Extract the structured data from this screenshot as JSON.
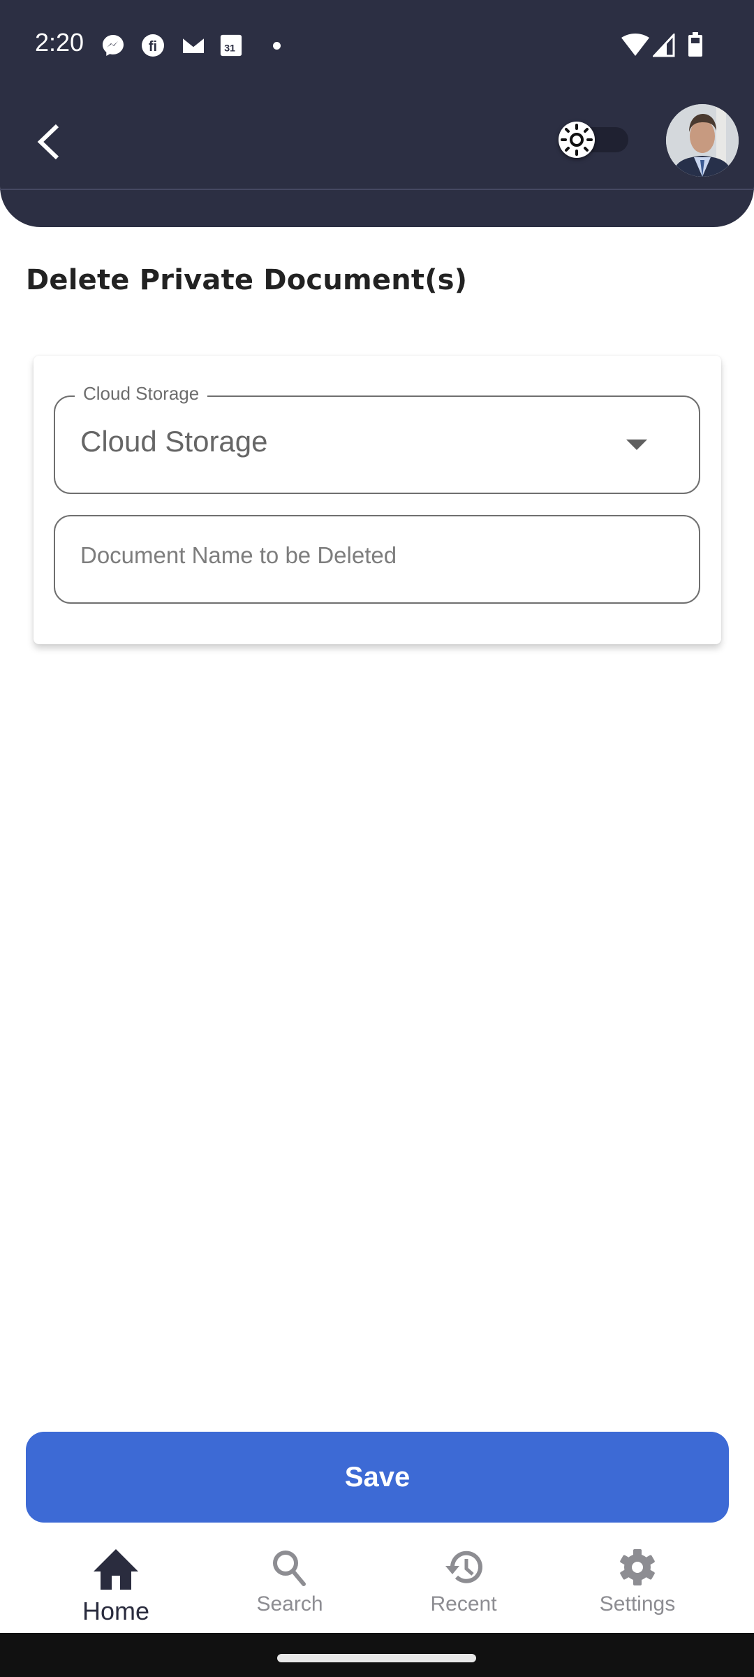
{
  "status_bar": {
    "time": "2:20",
    "notification_icons": [
      "messenger-icon",
      "fi-icon",
      "gmail-icon",
      "calendar-icon",
      "more-dot-icon"
    ],
    "calendar_day": "31",
    "system_icons": [
      "wifi-icon",
      "signal-icon",
      "battery-icon"
    ]
  },
  "header": {
    "back_icon": "chevron-left-icon",
    "theme_toggle": {
      "icon": "sun-icon",
      "state": "light"
    },
    "avatar": "user-avatar",
    "background_color": "#2c2f43"
  },
  "page": {
    "title": "Delete Private Document(s)"
  },
  "form": {
    "storage_select": {
      "label": "Cloud Storage",
      "value": "Cloud Storage"
    },
    "document_name": {
      "placeholder": "Document Name to be Deleted",
      "value": ""
    }
  },
  "actions": {
    "save_label": "Save",
    "save_color": "#3d6ad5"
  },
  "bottom_nav": {
    "items": [
      {
        "label": "Home",
        "icon": "home-icon",
        "active": true
      },
      {
        "label": "Search",
        "icon": "search-icon",
        "active": false
      },
      {
        "label": "Recent",
        "icon": "history-icon",
        "active": false
      },
      {
        "label": "Settings",
        "icon": "gear-icon",
        "active": false
      }
    ]
  }
}
